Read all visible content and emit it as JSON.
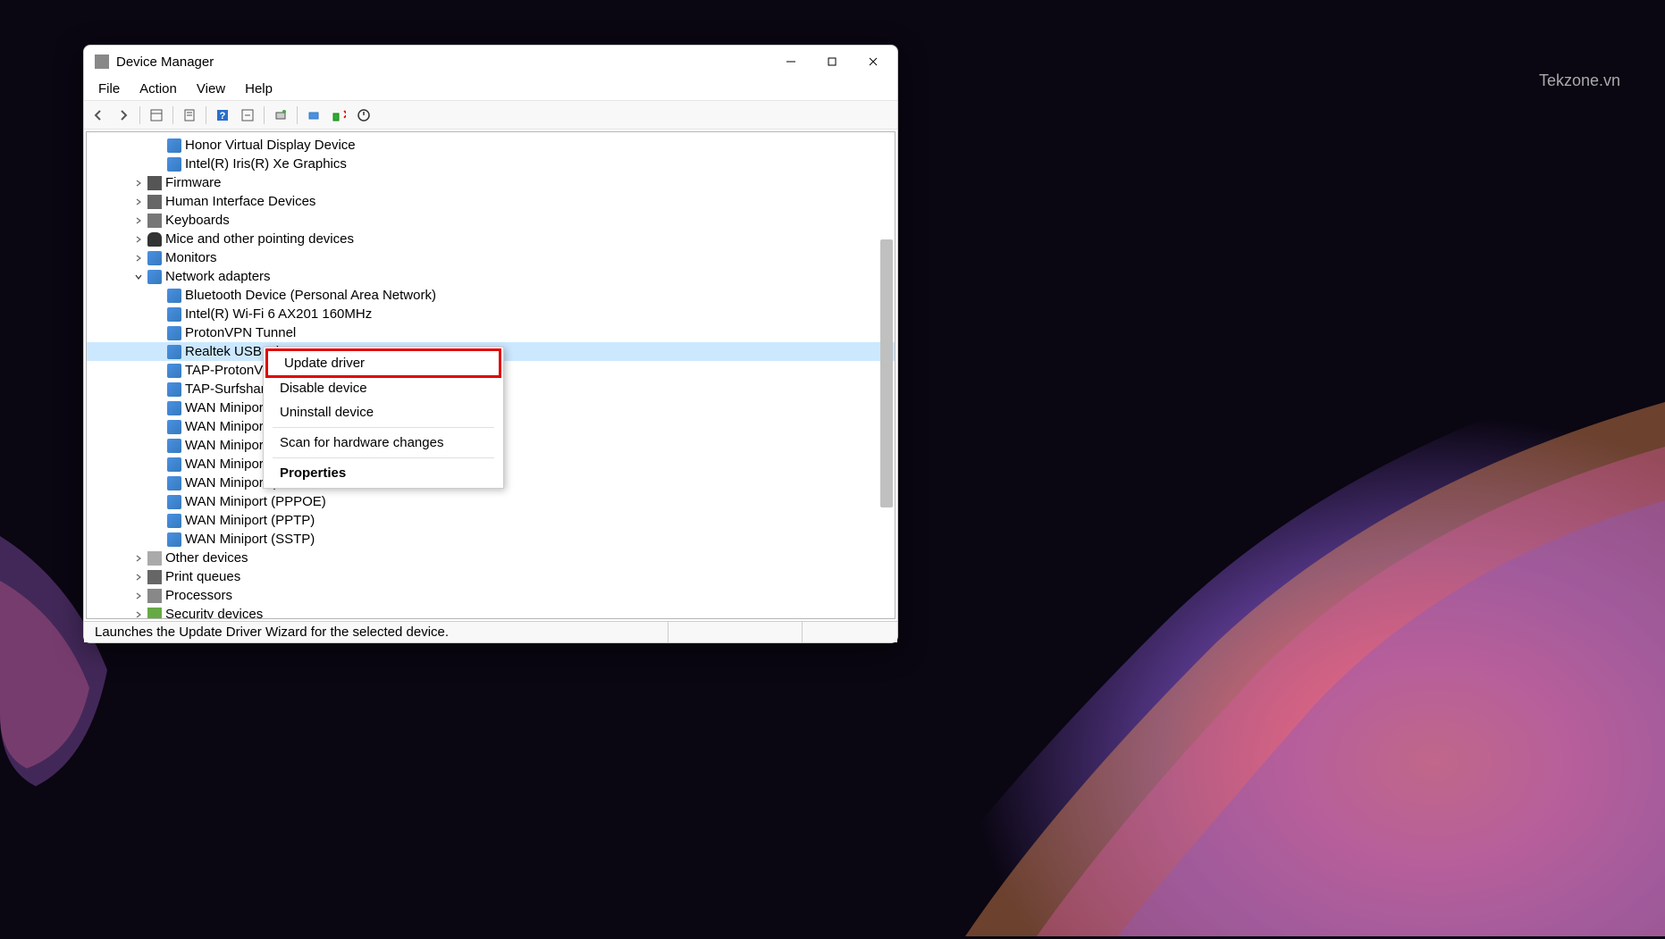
{
  "watermark": "Tekzone.vn",
  "window": {
    "title": "Device Manager"
  },
  "menubar": [
    "File",
    "Action",
    "View",
    "Help"
  ],
  "tree": {
    "items": [
      {
        "level": 2,
        "icon": "display",
        "label": "Honor Virtual Display Device",
        "expand": ""
      },
      {
        "level": 2,
        "icon": "display",
        "label": "Intel(R) Iris(R) Xe Graphics",
        "expand": ""
      },
      {
        "level": 1,
        "icon": "firmware",
        "label": "Firmware",
        "expand": ">"
      },
      {
        "level": 1,
        "icon": "hid",
        "label": "Human Interface Devices",
        "expand": ">"
      },
      {
        "level": 1,
        "icon": "keyboard",
        "label": "Keyboards",
        "expand": ">"
      },
      {
        "level": 1,
        "icon": "mouse",
        "label": "Mice and other pointing devices",
        "expand": ">"
      },
      {
        "level": 1,
        "icon": "monitor",
        "label": "Monitors",
        "expand": ">"
      },
      {
        "level": 1,
        "icon": "network",
        "label": "Network adapters",
        "expand": "v"
      },
      {
        "level": 2,
        "icon": "network",
        "label": "Bluetooth Device (Personal Area Network)",
        "expand": ""
      },
      {
        "level": 2,
        "icon": "network",
        "label": "Intel(R) Wi-Fi 6 AX201 160MHz",
        "expand": ""
      },
      {
        "level": 2,
        "icon": "network",
        "label": "ProtonVPN Tunnel",
        "expand": ""
      },
      {
        "level": 2,
        "icon": "network",
        "label": "Realtek USB GbE",
        "expand": "",
        "selected": true
      },
      {
        "level": 2,
        "icon": "network",
        "label": "TAP-ProtonVPN V",
        "expand": ""
      },
      {
        "level": 2,
        "icon": "network",
        "label": "TAP-Surfshark W",
        "expand": ""
      },
      {
        "level": 2,
        "icon": "network",
        "label": "WAN Miniport (I",
        "expand": ""
      },
      {
        "level": 2,
        "icon": "network",
        "label": "WAN Miniport (I",
        "expand": ""
      },
      {
        "level": 2,
        "icon": "network",
        "label": "WAN Miniport (I",
        "expand": ""
      },
      {
        "level": 2,
        "icon": "network",
        "label": "WAN Miniport (L",
        "expand": ""
      },
      {
        "level": 2,
        "icon": "network",
        "label": "WAN Miniport (N",
        "expand": ""
      },
      {
        "level": 2,
        "icon": "network",
        "label": "WAN Miniport (PPPOE)",
        "expand": ""
      },
      {
        "level": 2,
        "icon": "network",
        "label": "WAN Miniport (PPTP)",
        "expand": ""
      },
      {
        "level": 2,
        "icon": "network",
        "label": "WAN Miniport (SSTP)",
        "expand": ""
      },
      {
        "level": 1,
        "icon": "other",
        "label": "Other devices",
        "expand": ">"
      },
      {
        "level": 1,
        "icon": "print",
        "label": "Print queues",
        "expand": ">"
      },
      {
        "level": 1,
        "icon": "cpu",
        "label": "Processors",
        "expand": ">"
      },
      {
        "level": 1,
        "icon": "security",
        "label": "Security devices",
        "expand": ">"
      }
    ]
  },
  "context_menu": {
    "items": [
      {
        "label": "Update driver",
        "highlighted": true
      },
      {
        "label": "Disable device"
      },
      {
        "label": "Uninstall device"
      },
      {
        "separator": true
      },
      {
        "label": "Scan for hardware changes"
      },
      {
        "separator": true
      },
      {
        "label": "Properties",
        "bold": true
      }
    ]
  },
  "statusbar": {
    "text": "Launches the Update Driver Wizard for the selected device."
  }
}
